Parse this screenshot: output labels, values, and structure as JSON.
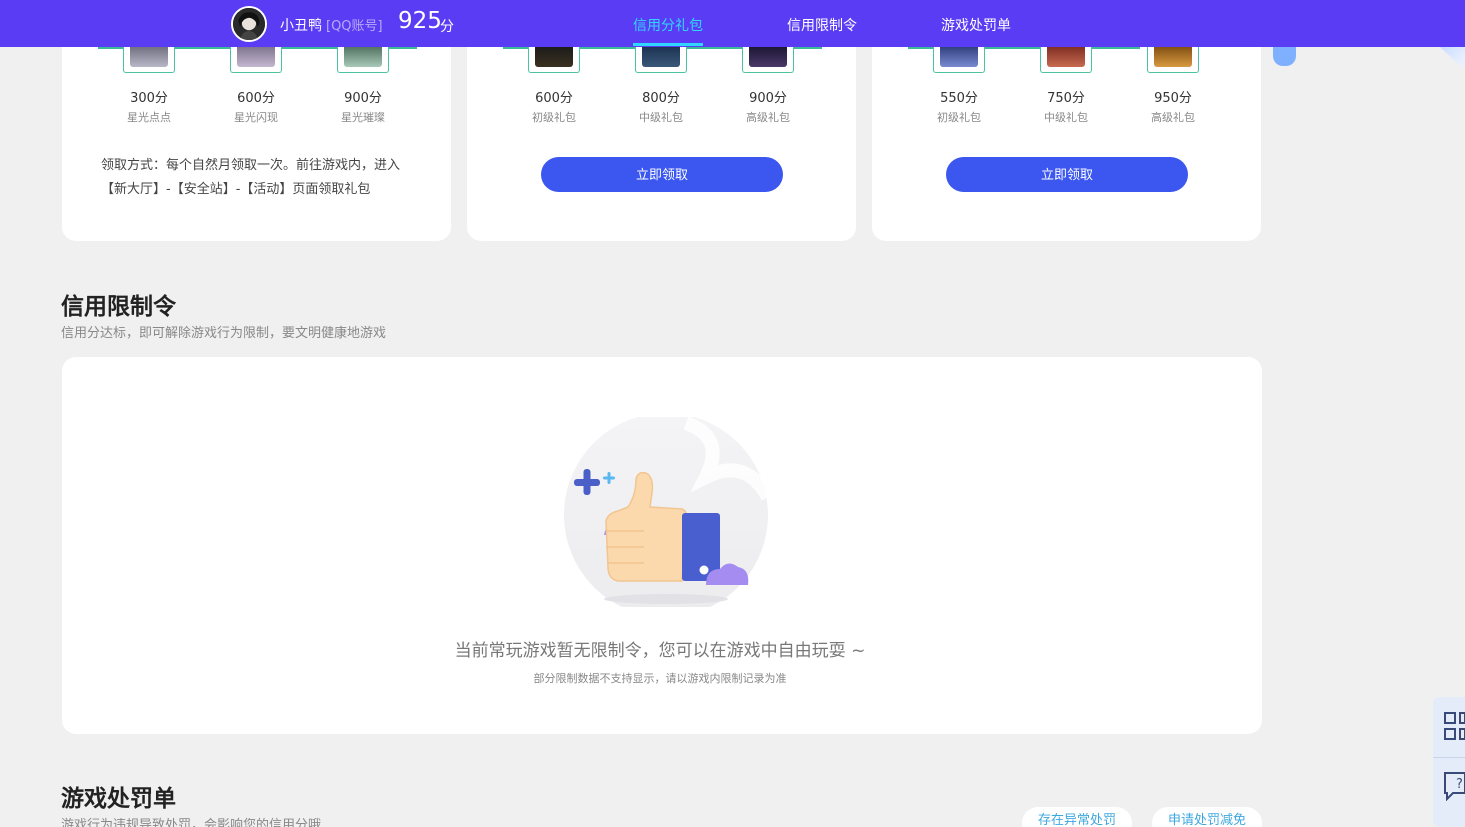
{
  "user": {
    "name": "小丑鸭",
    "account_type": "[QQ账号]",
    "score": "925",
    "score_unit": "分"
  },
  "nav": {
    "tabs": [
      {
        "label": "信用分礼包",
        "active": true
      },
      {
        "label": "信用限制令",
        "active": false
      },
      {
        "label": "游戏处罚单",
        "active": false
      }
    ]
  },
  "gift_cards": [
    {
      "gifts": [
        {
          "points": "300分",
          "name": "星光点点"
        },
        {
          "points": "600分",
          "name": "星光闪现"
        },
        {
          "points": "900分",
          "name": "星光璀璨"
        }
      ],
      "claim_text": "领取方式：每个自然月领取一次。前往游戏内，进入【新大厅】-【安全站】-【活动】页面领取礼包"
    },
    {
      "gifts": [
        {
          "points": "600分",
          "name": "初级礼包"
        },
        {
          "points": "800分",
          "name": "中级礼包"
        },
        {
          "points": "900分",
          "name": "高级礼包"
        }
      ],
      "button_label": "立即领取"
    },
    {
      "gifts": [
        {
          "points": "550分",
          "name": "初级礼包"
        },
        {
          "points": "750分",
          "name": "中级礼包"
        },
        {
          "points": "950分",
          "name": "高级礼包"
        }
      ],
      "button_label": "立即领取"
    }
  ],
  "restriction": {
    "title": "信用限制令",
    "subtitle": "信用分达标，即可解除游戏行为限制，要文明健康地游戏",
    "empty_message": "当前常玩游戏暂无限制令，您可以在游戏中自由玩耍 ~",
    "empty_note": "部分限制数据不支持显示，请以游戏内限制记录为准"
  },
  "penalty": {
    "title": "游戏处罚单",
    "subtitle": "游戏行为违规导致处罚，会影响您的信用分哦",
    "buttons": [
      "存在异常处罚",
      "申请处罚减免"
    ]
  },
  "colors": {
    "topbar": "#5b3cf5",
    "active_tab": "#31d6ff",
    "primary_button": "#3b57f0",
    "strip": "#3cb89a"
  }
}
